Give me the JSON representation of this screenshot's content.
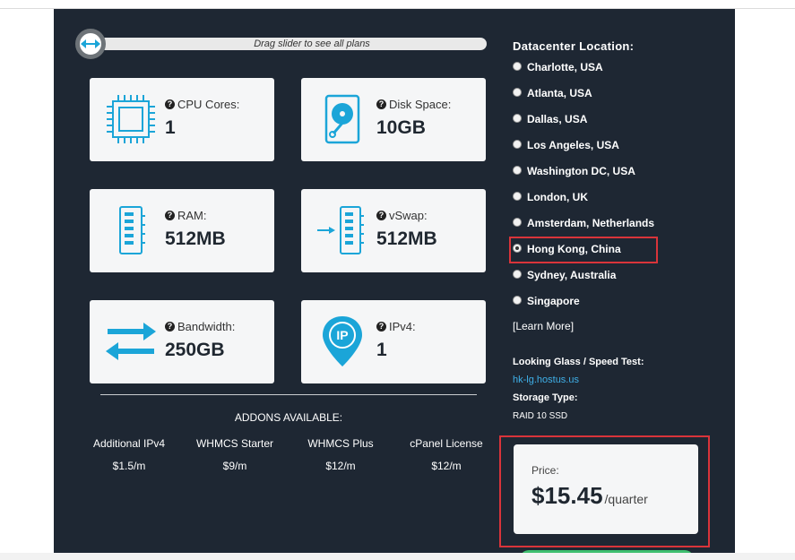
{
  "slider": {
    "text": "Drag slider to see all plans"
  },
  "specs": [
    {
      "label": "CPU Cores:",
      "value": "1",
      "icon": "cpu-icon"
    },
    {
      "label": "Disk Space:",
      "value": "10GB",
      "icon": "disk-icon"
    },
    {
      "label": "RAM:",
      "value": "512MB",
      "icon": "ram-icon"
    },
    {
      "label": "vSwap:",
      "value": "512MB",
      "icon": "vswap-icon"
    },
    {
      "label": "Bandwidth:",
      "value": "250GB",
      "icon": "bandwidth-icon"
    },
    {
      "label": "IPv4:",
      "value": "1",
      "icon": "ip-icon"
    }
  ],
  "addons": {
    "title": "ADDONS AVAILABLE:",
    "items": [
      {
        "name": "Additional IPv4",
        "price": "$1.5/m"
      },
      {
        "name": "WHMCS Starter",
        "price": "$9/m"
      },
      {
        "name": "WHMCS Plus",
        "price": "$12/m"
      },
      {
        "name": "cPanel License",
        "price": "$12/m"
      }
    ]
  },
  "datacenter": {
    "title": "Datacenter Location:",
    "selected": "Hong Kong, China",
    "locations": [
      "Charlotte, USA",
      "Atlanta, USA",
      "Dallas, USA",
      "Los Angeles, USA",
      "Washington DC, USA",
      "London, UK",
      "Amsterdam, Netherlands",
      "Hong Kong, China",
      "Sydney, Australia",
      "Singapore"
    ],
    "learn_more": "[Learn More]"
  },
  "looking_glass": {
    "label": "Looking Glass / Speed Test:",
    "link": "hk-lg.hostus.us"
  },
  "storage": {
    "label": "Storage Type:",
    "value": "RAID 10 SSD"
  },
  "price": {
    "label": "Price:",
    "amount": "$15.45",
    "period": "/quarter"
  },
  "colors": {
    "panel": "#1e2733",
    "accent": "#1ba5d8",
    "link": "#3fb0e8",
    "highlight": "#d9343a"
  }
}
